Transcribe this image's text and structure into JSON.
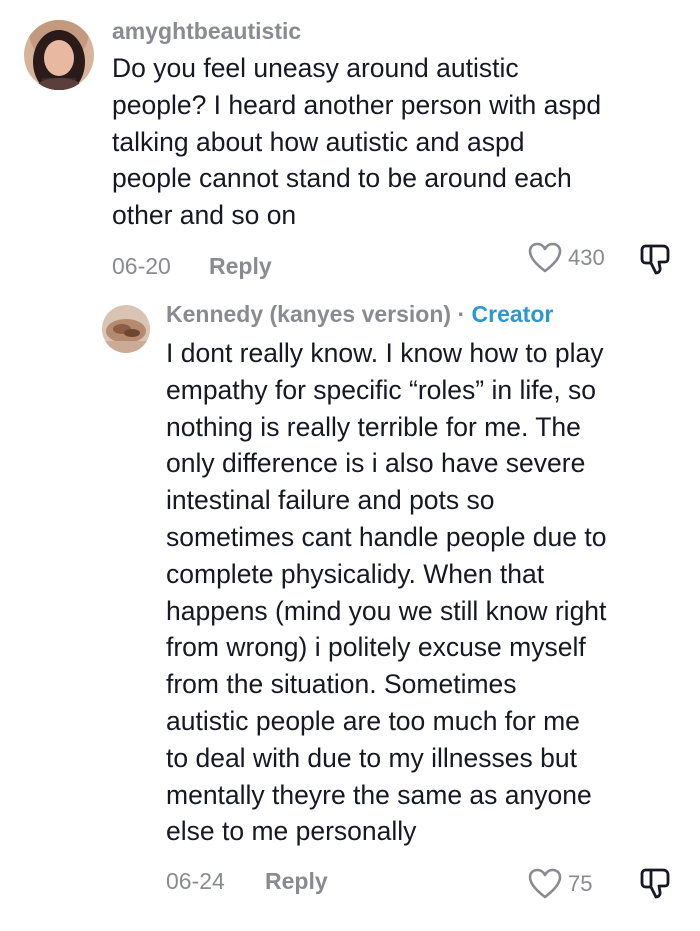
{
  "comments": [
    {
      "username": "amyghtbeautistic",
      "text": "Do you feel uneasy around autistic\npeople? I heard another person with aspd\ntalking about how autistic and aspd\npeople cannot stand to be around each\nother and so on",
      "date": "06-20",
      "reply_label": "Reply",
      "likes": "430",
      "colors": {
        "avatar_bg": "#c9a48a",
        "hair": "#2a1a1a",
        "face": "#e8b9a0"
      }
    },
    {
      "username": "Kennedy (kanyes version)",
      "separator": "·",
      "badge": "Creator",
      "text": "I dont really know. I know how to play\nempathy for specific “roles” in life, so\nnothing is really terrible for me. The\nonly difference is i also have severe\nintestinal failure and pots so\nsometimes cant handle people due to\ncomplete physicalidy. When that\nhappens (mind you we still know right\nfrom wrong) i politely excuse myself\nfrom the situation. Sometimes\nautistic people are too much for me\nto deal with due to my illnesses but\nmentally theyre the same as anyone\nelse to me personally",
      "date": "06-24",
      "reply_label": "Reply",
      "likes": "75",
      "colors": {
        "avatar_bg": "#b58a6f",
        "accent": "#7a5040"
      }
    }
  ],
  "colors": {
    "text_primary": "#161823",
    "text_secondary": "#8a8b91",
    "creator": "#2c97d3",
    "icon": "#8a8b91"
  }
}
